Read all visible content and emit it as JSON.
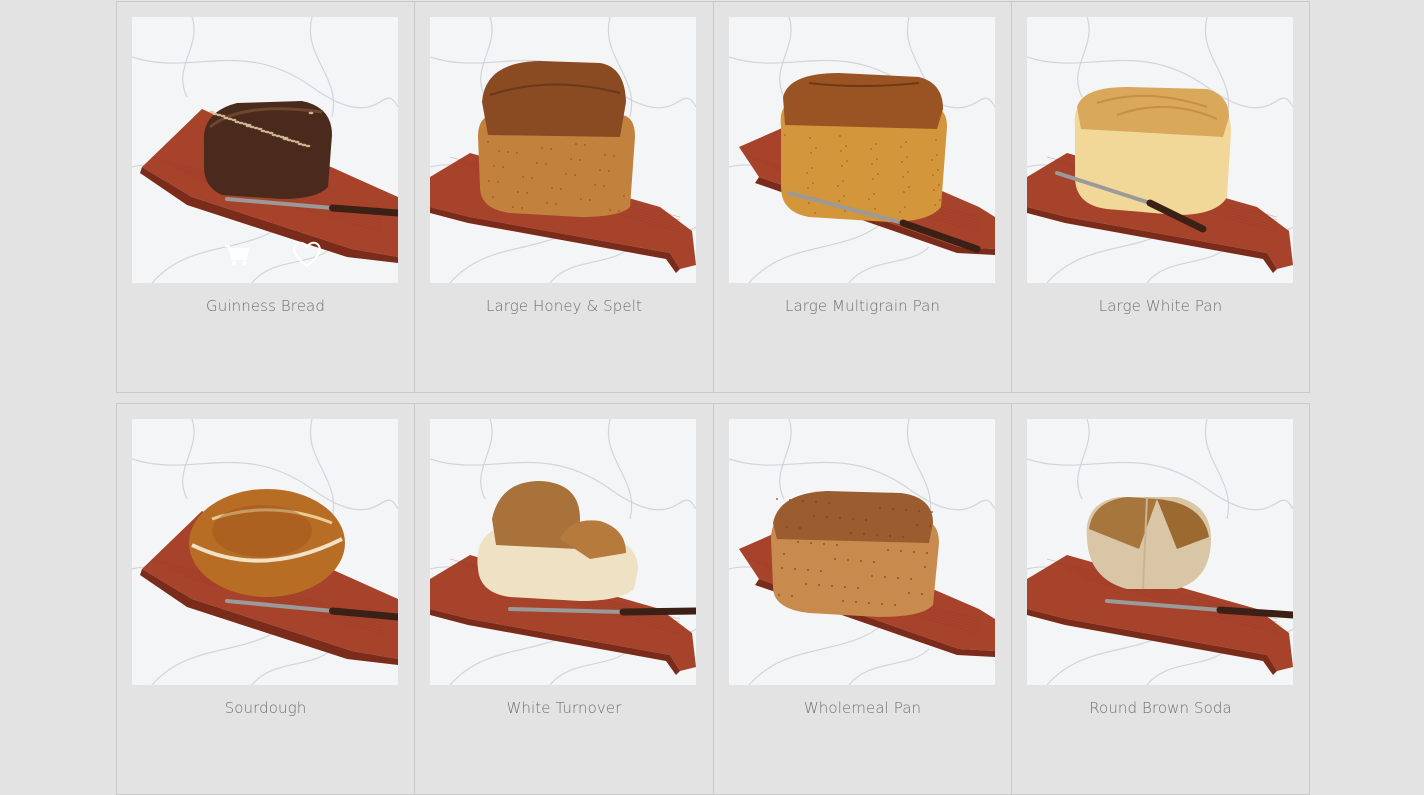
{
  "products": [
    {
      "name": "Guinness Bread",
      "crust": "#4a2a1c",
      "crumb": "#5c3624",
      "shape": "loaf-small",
      "seeds": true,
      "show_actions": true
    },
    {
      "name": "Large Honey & Spelt",
      "crust": "#8a4a22",
      "crumb": "#c2823d",
      "shape": "tin",
      "seeds": false,
      "show_actions": false
    },
    {
      "name": "Large Multigrain Pan",
      "crust": "#9a5423",
      "crumb": "#d3963b",
      "shape": "tin-long",
      "seeds": false,
      "show_actions": false
    },
    {
      "name": "Large White Pan",
      "crust": "#d9a85a",
      "crumb": "#f1d899",
      "shape": "tin-white",
      "seeds": false,
      "show_actions": false
    },
    {
      "name": "Sourdough",
      "crust": "#b86d25",
      "crumb": "#e8c48a",
      "shape": "round",
      "seeds": false,
      "show_actions": false
    },
    {
      "name": "White Turnover",
      "crust": "#a8723a",
      "crumb": "#efe1c3",
      "shape": "turnover",
      "seeds": false,
      "show_actions": false
    },
    {
      "name": "Wholemeal Pan",
      "crust": "#9b5d2f",
      "crumb": "#c98a4d",
      "shape": "tin-wholemeal",
      "seeds": false,
      "show_actions": false
    },
    {
      "name": "Round Brown Soda",
      "crust": "#a7763c",
      "crumb": "#d9c6a6",
      "shape": "soda",
      "seeds": false,
      "show_actions": false
    }
  ],
  "icons": {
    "cart": "cart-icon",
    "wishlist": "heart-icon"
  },
  "colors": {
    "page_bg": "#e3e3e3",
    "card_border": "#c9c9c9",
    "title_text": "#6f6f6f",
    "board": "#a8432b",
    "board_dark": "#7a2b1a",
    "marble": "#f4f5f6"
  }
}
